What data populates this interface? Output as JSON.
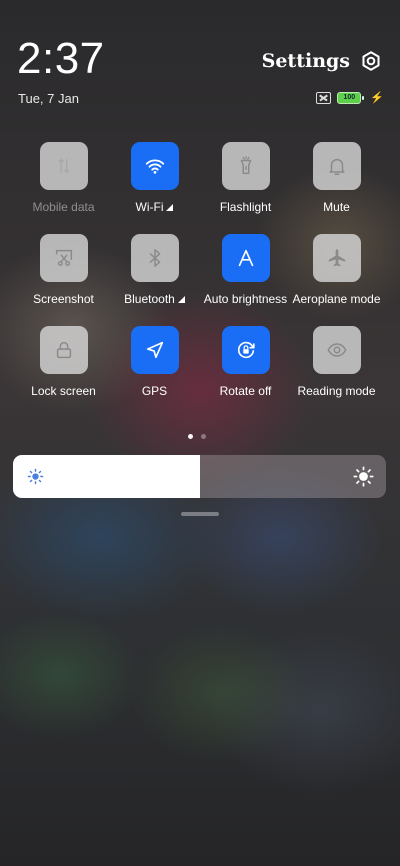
{
  "header": {
    "time": "2:37",
    "date": "Tue, 7 Jan",
    "settings_label": "Settings",
    "settings_icon": "gear-icon",
    "battery_level": "100"
  },
  "tiles": [
    {
      "label": "Mobile data",
      "icon": "mobile-data-icon",
      "active": false,
      "dim": true
    },
    {
      "label": "Wi-Fi",
      "icon": "wifi-icon",
      "active": true,
      "expand": true
    },
    {
      "label": "Flashlight",
      "icon": "flashlight-icon",
      "active": false
    },
    {
      "label": "Mute",
      "icon": "bell-icon",
      "active": false
    },
    {
      "label": "Screenshot",
      "icon": "screenshot-icon",
      "active": false
    },
    {
      "label": "Bluetooth",
      "icon": "bluetooth-icon",
      "active": false,
      "expand": true
    },
    {
      "label": "Auto brightness",
      "icon": "auto-brightness-icon",
      "active": true
    },
    {
      "label": "Aeroplane mode",
      "icon": "airplane-icon",
      "active": false
    },
    {
      "label": "Lock screen",
      "icon": "lock-icon",
      "active": false
    },
    {
      "label": "GPS",
      "icon": "location-arrow-icon",
      "active": true
    },
    {
      "label": "Rotate off",
      "icon": "rotation-lock-icon",
      "active": true
    },
    {
      "label": "Reading mode",
      "icon": "eye-icon",
      "active": false
    }
  ],
  "pager": {
    "pages": 2,
    "current": 1
  },
  "brightness": {
    "level": 0.5
  },
  "colors": {
    "accent": "#1a6ef5",
    "tile_inactive": "#d6d6d6",
    "battery": "#5ed14a"
  }
}
